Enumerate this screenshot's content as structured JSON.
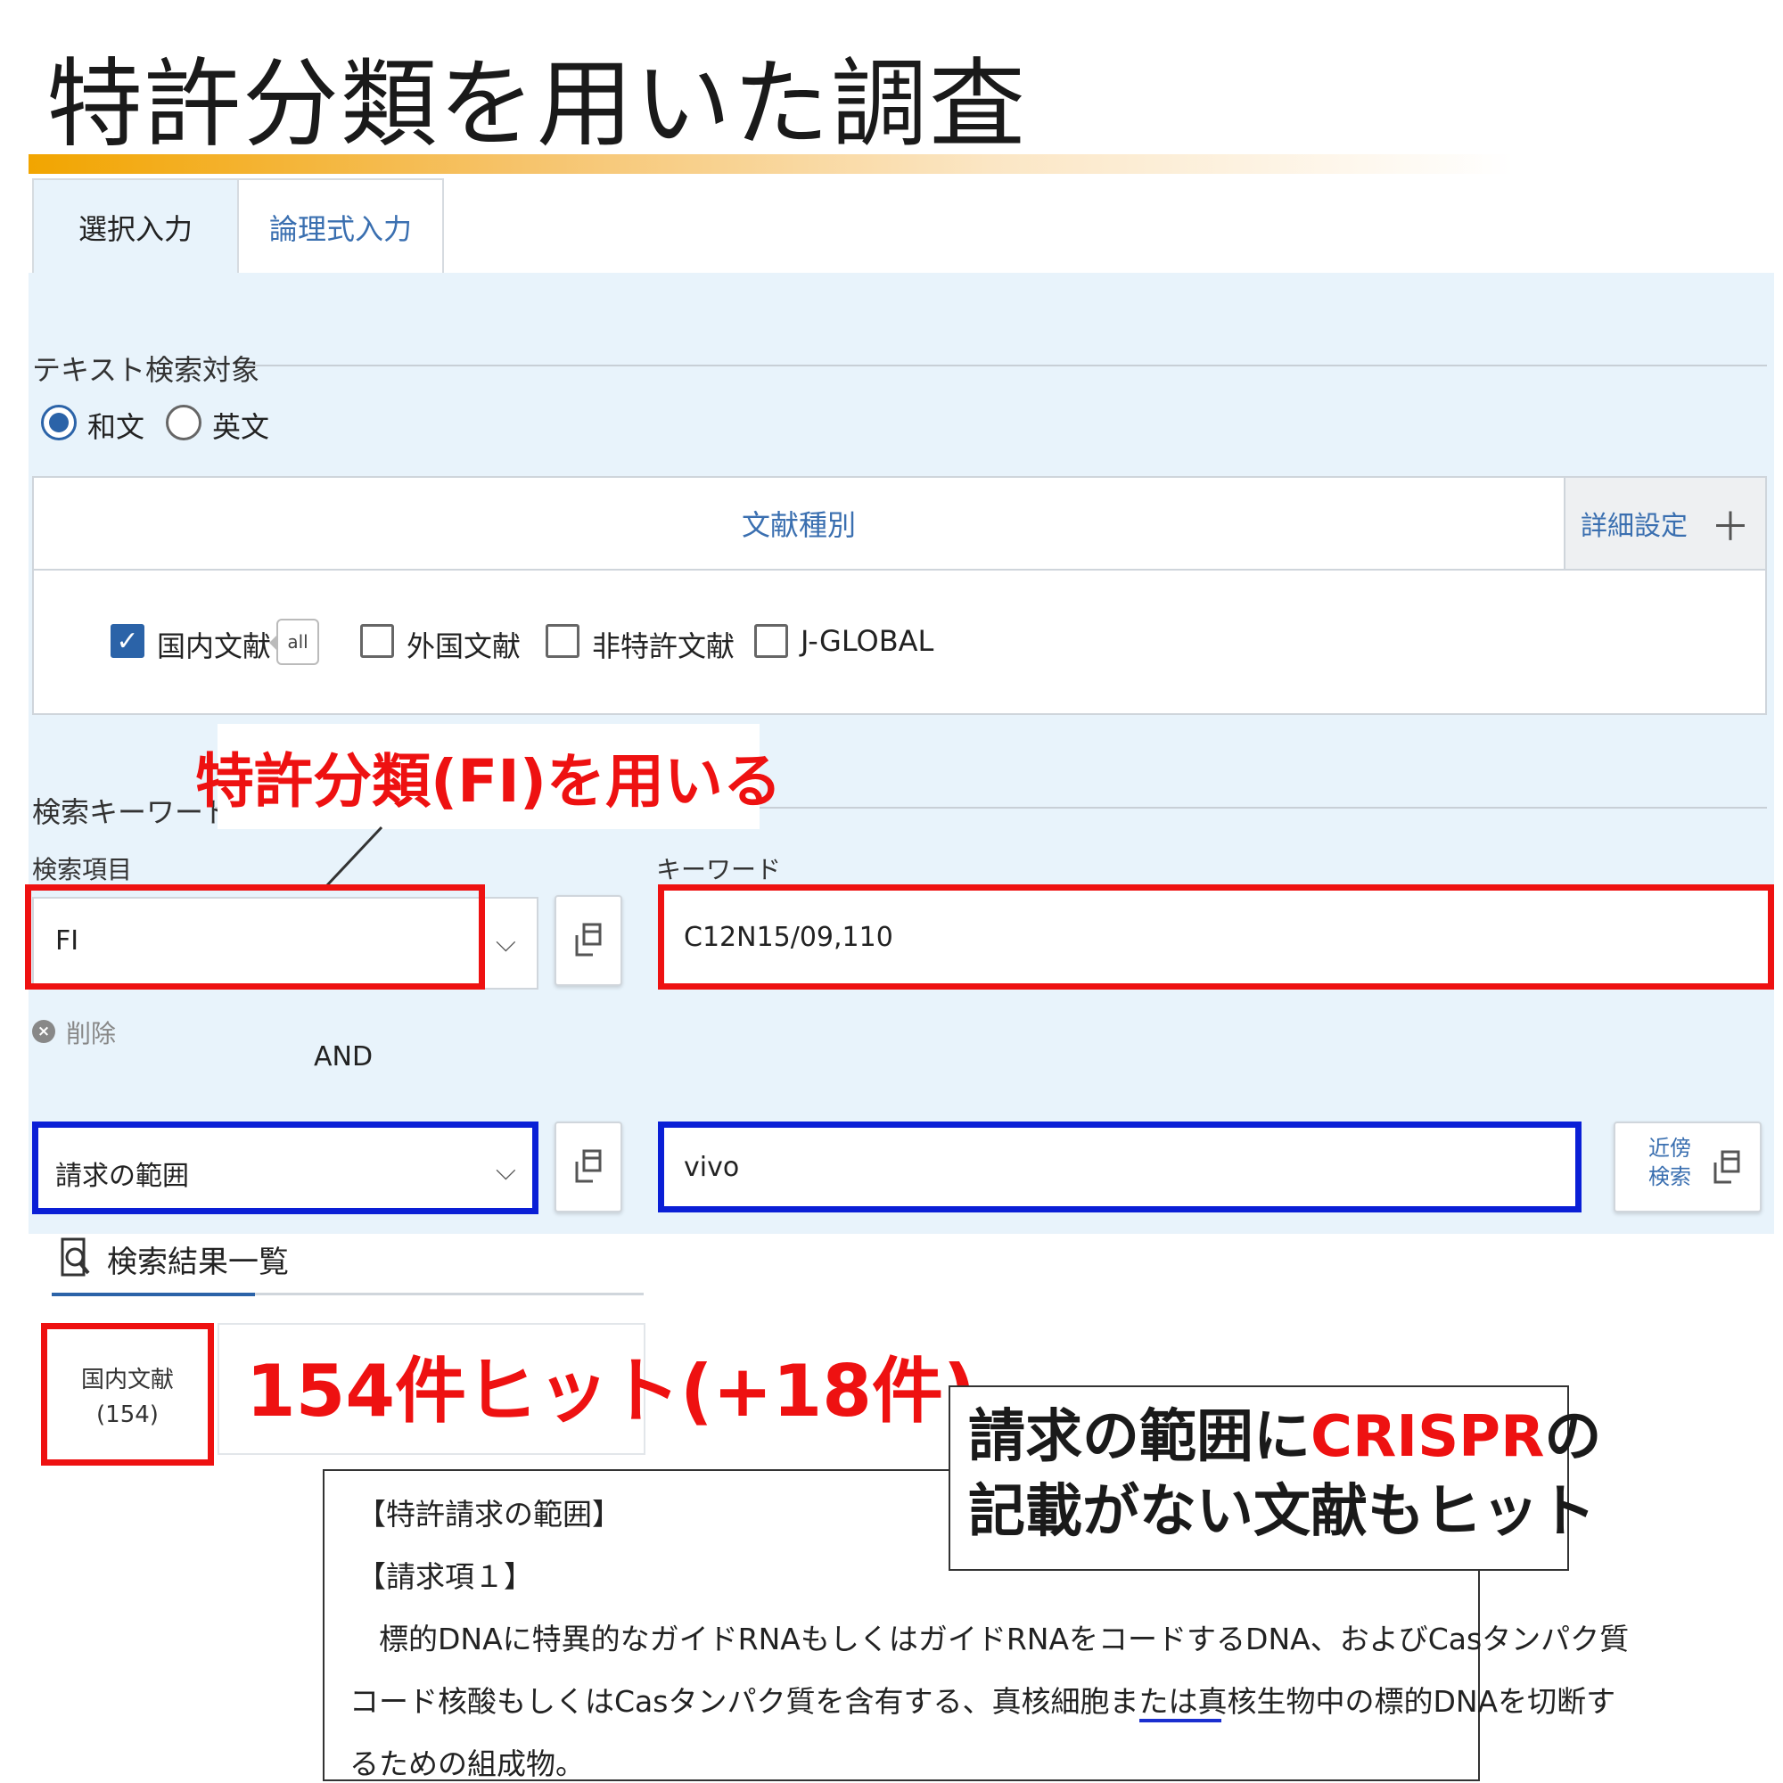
{
  "slide": {
    "title": "特許分類を用いた調査"
  },
  "tabs": [
    {
      "label": "選択入力",
      "active": true
    },
    {
      "label": "論理式入力",
      "active": false
    }
  ],
  "text_target": {
    "heading": "テキスト検索対象",
    "options": [
      {
        "label": "和文",
        "selected": true
      },
      {
        "label": "英文",
        "selected": false
      }
    ]
  },
  "document_type": {
    "header": "文献種別",
    "detail_settings": "詳細設定",
    "detail_plus": "＋",
    "badge": "all",
    "options": [
      {
        "label": "国内文献",
        "checked": true
      },
      {
        "label": "外国文献",
        "checked": false
      },
      {
        "label": "非特許文献",
        "checked": false
      },
      {
        "label": "J-GLOBAL",
        "checked": false
      }
    ]
  },
  "keywords": {
    "heading": "検索キーワード",
    "item_label": "検索項目",
    "keyword_label": "キーワード",
    "rows": [
      {
        "field": "FI",
        "value": "C12N15/09,110"
      },
      {
        "field": "請求の範囲",
        "value": "vivo"
      }
    ],
    "delete_label": "削除",
    "operator": "AND",
    "near_button": [
      "近傍",
      "検索"
    ]
  },
  "results": {
    "heading": "検索結果一覧",
    "tab_name": "国内文献",
    "tab_count": "(154)"
  },
  "annotations": {
    "fi_callout": "特許分類(FI)を用いる",
    "hits": "154件ヒット(+18件)",
    "note_line1_prefix": "請求の範囲に",
    "note_line1_highlight": "CRISPR",
    "note_line1_suffix": "の",
    "note_line2": "記載がない文献もヒット"
  },
  "claims": {
    "lines": [
      "【特許請求の範囲】",
      "【請求項１】",
      "　標的DNAに特異的なガイドRNAもしくはガイドRNAをコードするDNA、およびCasタンパク質",
      "コード核酸もしくはCasタンパク質を含有する、真核細胞または真核生物中の標的DNAを切断す",
      "るための組成物。"
    ]
  },
  "colors": {
    "annotation_red": "#ee1111",
    "annotation_blue": "#0a1fd6",
    "panel_bg": "#e8f3fb",
    "link_blue": "#3a6fb0",
    "title_bar": "#f2a500"
  }
}
